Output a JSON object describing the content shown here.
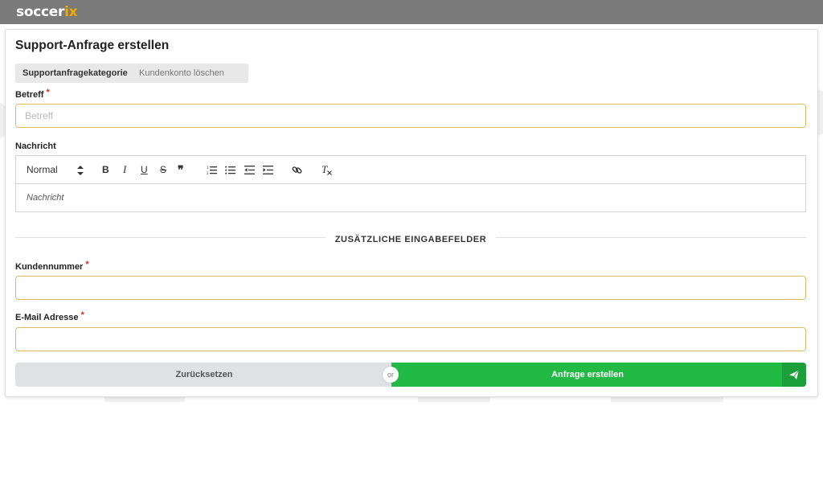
{
  "brand": {
    "name_part1": "soccer",
    "name_part2": "ix",
    "accent_color": "#f2a900",
    "header_color": "#7a7a7a"
  },
  "form": {
    "title": "Support-Anfrage erstellen",
    "category_label": "Supportanfragekategorie",
    "category_value": "Kundenkonto löschen",
    "subject": {
      "label": "Betreff",
      "required_mark": "*",
      "placeholder": "Betreff",
      "value": ""
    },
    "message": {
      "label": "Nachricht",
      "placeholder": "Nachricht",
      "toolbar": {
        "format_select": "Normal",
        "format_arrows": "⇕",
        "bold": "B",
        "italic": "I",
        "underline": "U",
        "strike": "S",
        "quote": "❞",
        "clear_format": "T"
      }
    },
    "section_divider": "ZUSÄTZLICHE EINGABEFELDER",
    "customer_number": {
      "label": "Kundennummer",
      "required_mark": "*",
      "value": ""
    },
    "email": {
      "label": "E-Mail Adresse",
      "required_mark": "*",
      "value": ""
    },
    "buttons": {
      "reset": "Zurücksetzen",
      "or": "or",
      "submit": "Anfrage erstellen"
    }
  },
  "colors": {
    "required": "#db2828",
    "input_border": "#e3b95e",
    "submit": "#21ba45",
    "submit_dark": "#1a9f3b",
    "reset": "#e0e1e2"
  },
  "icons": [
    "sort-arrows-icon",
    "bold-icon",
    "italic-icon",
    "underline-icon",
    "strikethrough-icon",
    "quote-icon",
    "ordered-list-icon",
    "bullet-list-icon",
    "outdent-icon",
    "indent-icon",
    "link-icon",
    "clear-format-icon",
    "send-icon"
  ]
}
